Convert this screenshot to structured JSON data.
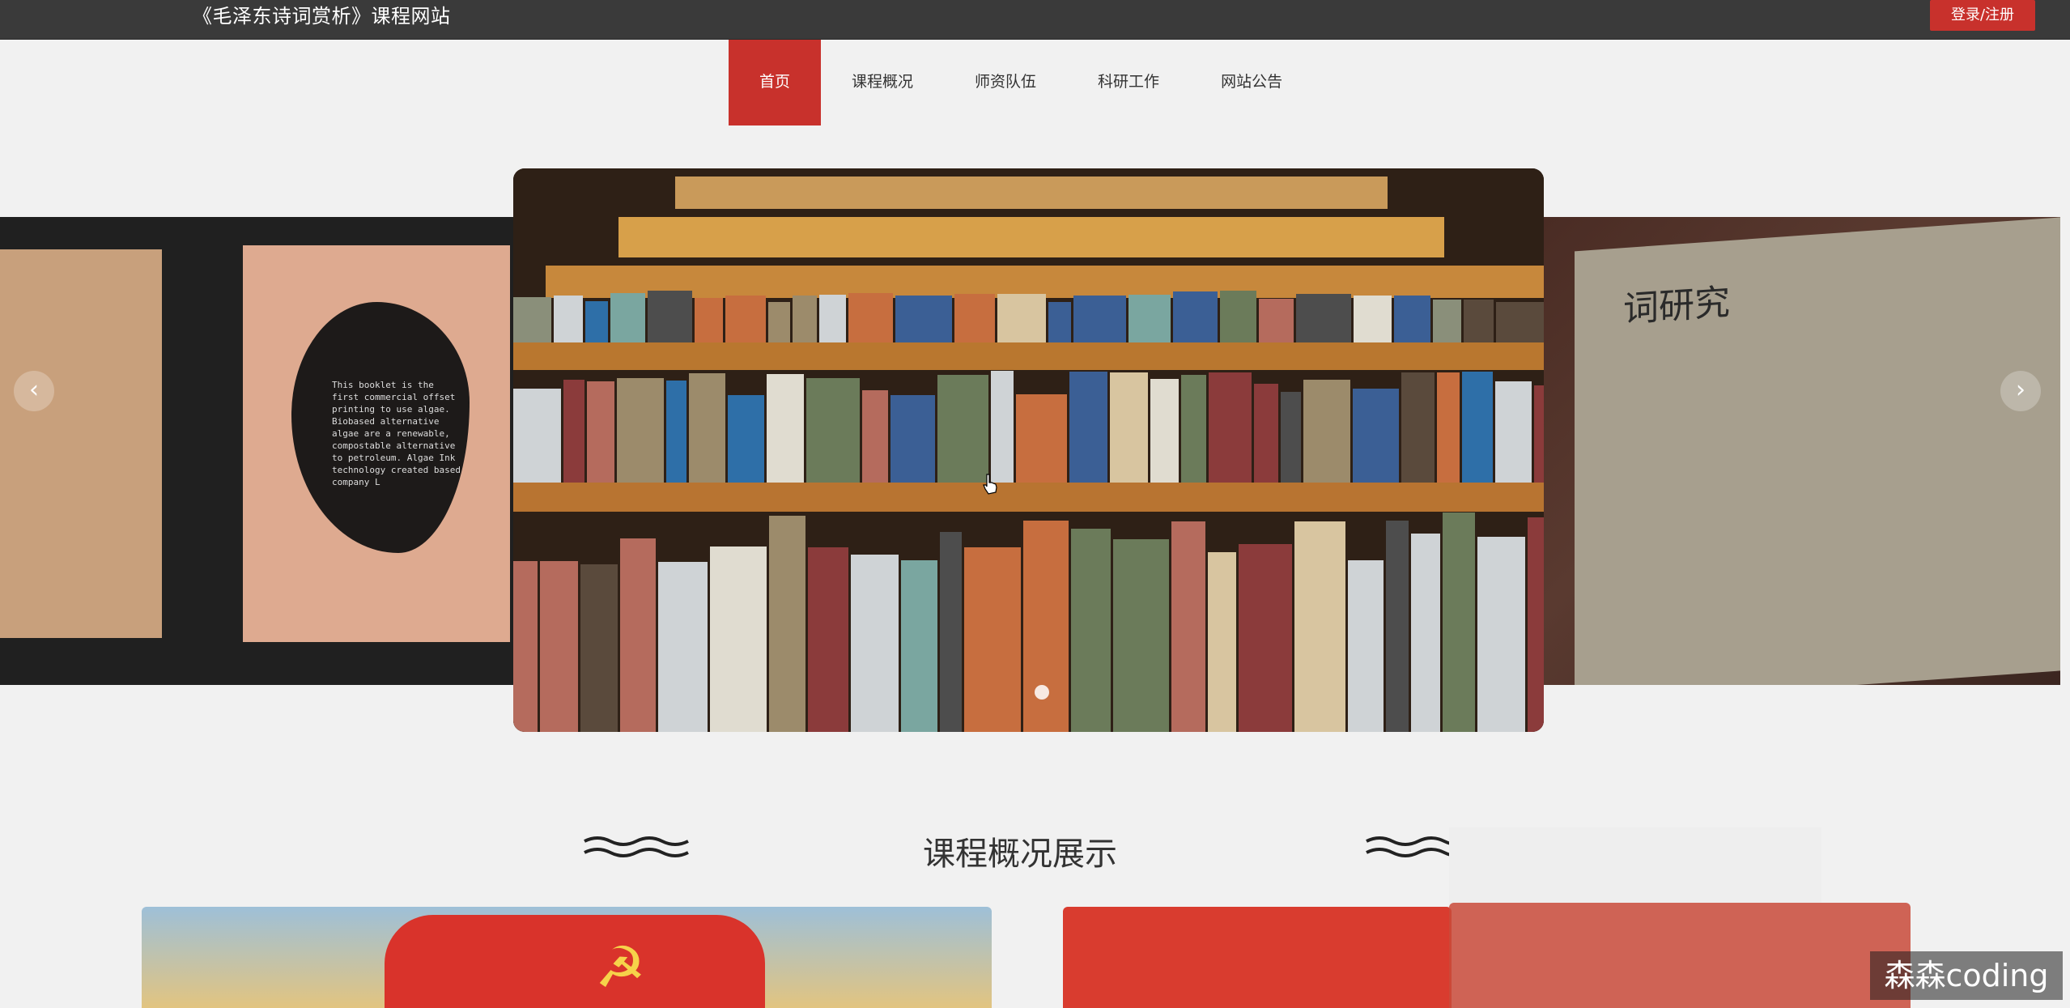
{
  "header": {
    "site_title": "《毛泽东诗词赏析》课程网站",
    "login_label": "登录/注册"
  },
  "nav": {
    "items": [
      {
        "label": "首页",
        "active": true
      },
      {
        "label": "课程概况",
        "active": false
      },
      {
        "label": "师资队伍",
        "active": false
      },
      {
        "label": "科研工作",
        "active": false
      },
      {
        "label": "网站公告",
        "active": false
      }
    ]
  },
  "carousel": {
    "prev_icon": "chevron-left-icon",
    "next_icon": "chevron-right-icon",
    "prev_glyph": "‹",
    "next_glyph": "›",
    "left_slide_text": "This booklet is the first commercial offset printing to use algae. Biobased alternative algae are a renewable, compostable alternative to petroleum. Algae Ink technology created based company L",
    "right_slide_text": "词研究"
  },
  "section": {
    "title": "课程概况展示"
  },
  "watermark": "森森coding",
  "colors": {
    "accent": "#c8312c",
    "topbar": "#3a3a3a"
  }
}
